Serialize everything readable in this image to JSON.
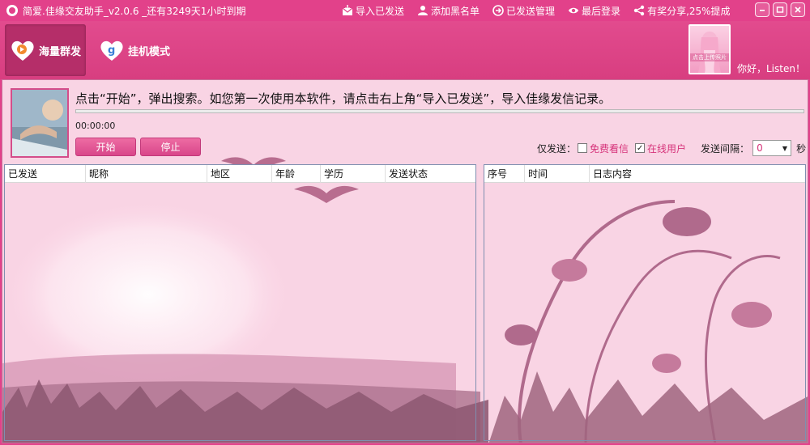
{
  "window": {
    "title": "简爱.佳缘交友助手_v2.0.6 _还有3249天1小时到期",
    "actions": [
      {
        "label": "导入已发送",
        "icon": "import-icon"
      },
      {
        "label": "添加黑名单",
        "icon": "user-icon"
      },
      {
        "label": "已发送管理",
        "icon": "arrow-circle-icon"
      },
      {
        "label": "最后登录",
        "icon": "eye-icon"
      },
      {
        "label": "有奖分享,25%提成",
        "icon": "share-icon"
      }
    ]
  },
  "toolbar": {
    "modes": [
      {
        "label": "海量群发",
        "icon": "heart-send-icon",
        "active": true
      },
      {
        "label": "挂机模式",
        "icon": "heart-g-icon",
        "active": false
      }
    ],
    "avatar_caption": "点击上传照片",
    "greeting": "你好，Listen！"
  },
  "main": {
    "instruction": "点击“开始”，弹出搜索。如您第一次使用本软件，请点击右上角“导入已发送”，导入佳缘发信记录。",
    "timer": "00:00:00",
    "progress_fraction": 0,
    "start_label": "开始",
    "stop_label": "停止",
    "options": {
      "only_send_label": "仅发送：",
      "free_view_label": "免费看信",
      "free_view_checked": false,
      "online_label": "在线用户",
      "online_checked": true,
      "interval_label": "发送间隔：",
      "interval_value": "0",
      "unit_label": "秒"
    }
  },
  "left_table": {
    "columns": [
      "已发送",
      "昵称",
      "地区",
      "年龄",
      "学历",
      "发送状态"
    ],
    "rows": []
  },
  "right_table": {
    "columns": [
      "序号",
      "时间",
      "日志内容"
    ],
    "rows": []
  },
  "colors": {
    "brand": "#e2418a",
    "panel": "#f9d2e3",
    "accent_text": "#d6337a"
  }
}
